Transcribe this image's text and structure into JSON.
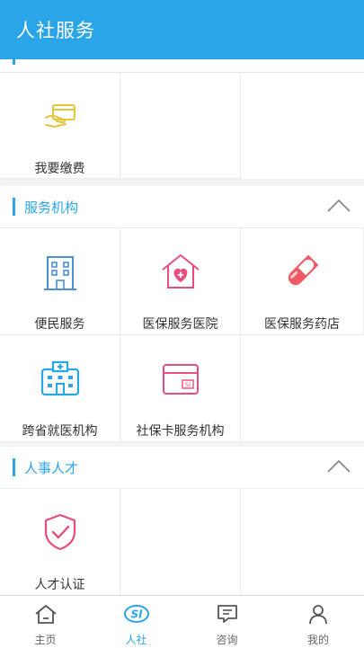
{
  "header": {
    "title": "人社服务"
  },
  "sections": {
    "top_row": {
      "items": [
        {
          "label": "我要缴费",
          "icon": "card-payment-icon"
        }
      ]
    },
    "service_org": {
      "title": "服务机构",
      "items": [
        {
          "label": "便民服务",
          "icon": "building-icon"
        },
        {
          "label": "医保服务医院",
          "icon": "hospital-house-icon"
        },
        {
          "label": "医保服务药店",
          "icon": "pill-capsule-icon"
        },
        {
          "label": "跨省就医机构",
          "icon": "medical-building-icon"
        },
        {
          "label": "社保卡服务机构",
          "icon": "si-card-icon"
        }
      ]
    },
    "talent": {
      "title": "人事人才",
      "items": [
        {
          "label": "人才认证",
          "icon": "shield-check-icon"
        }
      ]
    }
  },
  "bottom_nav": {
    "items": [
      {
        "label": "主页",
        "icon": "home-icon"
      },
      {
        "label": "人社",
        "icon": "si-logo-icon",
        "active": true
      },
      {
        "label": "咨询",
        "icon": "chat-icon"
      },
      {
        "label": "我的",
        "icon": "user-icon"
      }
    ]
  },
  "colors": {
    "accent": "#2aa5e8",
    "pink": "#e94d7b",
    "red": "#ef5a64",
    "yellow": "#e6c53a",
    "blue": "#2aa5e8"
  }
}
